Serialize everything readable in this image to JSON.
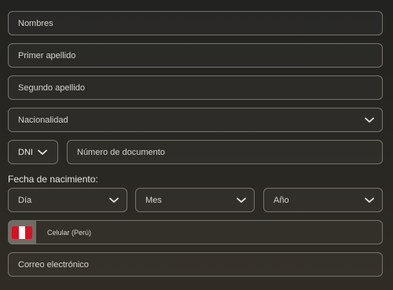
{
  "form": {
    "nombres_placeholder": "Nombres",
    "primer_apellido_placeholder": "Primer apellido",
    "segundo_apellido_placeholder": "Segundo apellido",
    "nacionalidad": "Nacionalidad",
    "doc_type": "DNI",
    "doc_number_placeholder": "Número de documento",
    "birth_label": "Fecha de nacimiento:",
    "dia": "Día",
    "mes": "Mes",
    "anio": "Año",
    "phone_placeholder": "Celular (Perú)",
    "email_placeholder": "Correo electrónico"
  },
  "icons": {
    "chevron": "chevron-down-icon",
    "flag": "peru-flag-icon"
  }
}
